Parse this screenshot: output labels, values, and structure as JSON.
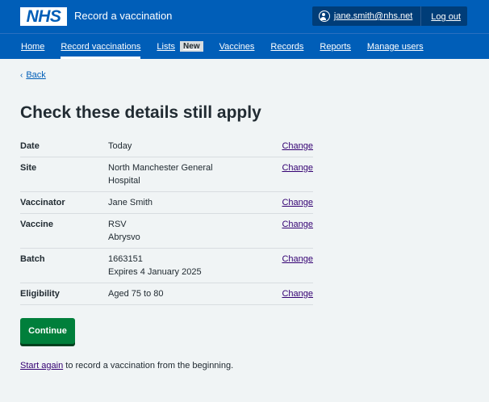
{
  "header": {
    "logo": "NHS",
    "service_name": "Record a vaccination",
    "user_email": "jane.smith@nhs.net",
    "logout": "Log out"
  },
  "nav": {
    "items": [
      {
        "label": "Home"
      },
      {
        "label": "Record vaccinations",
        "active": true
      },
      {
        "label": "Lists",
        "badge": "New"
      },
      {
        "label": "Vaccines"
      },
      {
        "label": "Records"
      },
      {
        "label": "Reports"
      },
      {
        "label": "Manage users"
      }
    ]
  },
  "back": "Back",
  "page_title": "Check these details still apply",
  "summary": {
    "change_label": "Change",
    "rows": [
      {
        "key": "Date",
        "value": "Today",
        "value2": ""
      },
      {
        "key": "Site",
        "value": "North Manchester General",
        "value2": "Hospital"
      },
      {
        "key": "Vaccinator",
        "value": "Jane Smith",
        "value2": ""
      },
      {
        "key": "Vaccine",
        "value": "RSV",
        "value2": "Abrysvo"
      },
      {
        "key": "Batch",
        "value": "1663151",
        "value2": "Expires 4 January 2025"
      },
      {
        "key": "Eligibility",
        "value": "Aged 75 to 80",
        "value2": ""
      }
    ]
  },
  "continue_label": "Continue",
  "start_again": {
    "link": "Start again",
    "text": " to record a vaccination from the beginning."
  },
  "colors": {
    "nhs_blue": "#005eb8",
    "green": "#007f3b",
    "link_visited": "#330072"
  }
}
